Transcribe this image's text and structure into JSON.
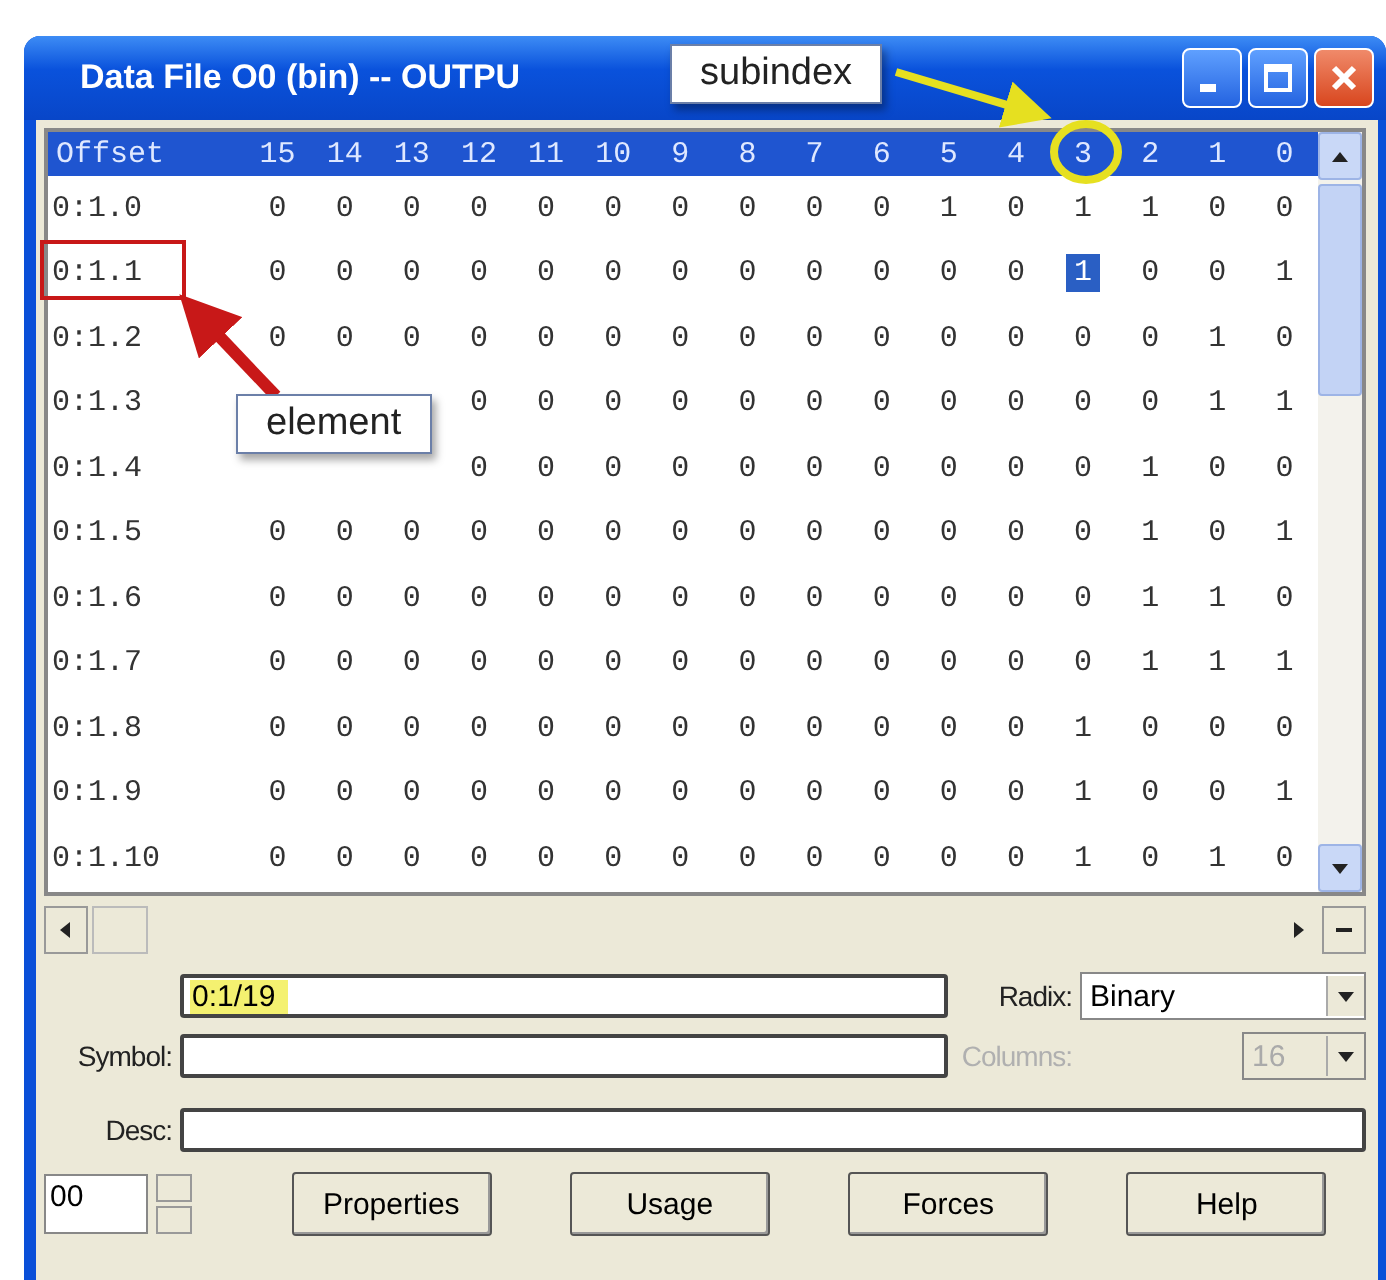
{
  "window": {
    "title": "Data File O0 (bin) -- OUTPU"
  },
  "table": {
    "columns": [
      "Offset",
      "15",
      "14",
      "13",
      "12",
      "11",
      "10",
      "9",
      "8",
      "7",
      "6",
      "5",
      "4",
      "3",
      "2",
      "1",
      "0"
    ],
    "rows": [
      {
        "cells": [
          {
            "v": "0:1.0",
            "selected": false
          },
          {
            "v": "0",
            "selected": false
          },
          {
            "v": "0",
            "selected": false
          },
          {
            "v": "0",
            "selected": false
          },
          {
            "v": "0",
            "selected": false
          },
          {
            "v": "0",
            "selected": false
          },
          {
            "v": "0",
            "selected": false
          },
          {
            "v": "0",
            "selected": false
          },
          {
            "v": "0",
            "selected": false
          },
          {
            "v": "0",
            "selected": false
          },
          {
            "v": "0",
            "selected": false
          },
          {
            "v": "1",
            "selected": false
          },
          {
            "v": "0",
            "selected": false
          },
          {
            "v": "1",
            "selected": false
          },
          {
            "v": "1",
            "selected": false
          },
          {
            "v": "0",
            "selected": false
          },
          {
            "v": "0",
            "selected": false
          }
        ]
      },
      {
        "cells": [
          {
            "v": "0:1.1",
            "selected": false
          },
          {
            "v": "0",
            "selected": false
          },
          {
            "v": "0",
            "selected": false
          },
          {
            "v": "0",
            "selected": false
          },
          {
            "v": "0",
            "selected": false
          },
          {
            "v": "0",
            "selected": false
          },
          {
            "v": "0",
            "selected": false
          },
          {
            "v": "0",
            "selected": false
          },
          {
            "v": "0",
            "selected": false
          },
          {
            "v": "0",
            "selected": false
          },
          {
            "v": "0",
            "selected": false
          },
          {
            "v": "0",
            "selected": false
          },
          {
            "v": "0",
            "selected": false
          },
          {
            "v": "1",
            "selected": true
          },
          {
            "v": "0",
            "selected": false
          },
          {
            "v": "0",
            "selected": false
          },
          {
            "v": "1",
            "selected": false
          }
        ]
      },
      {
        "cells": [
          {
            "v": "0:1.2",
            "selected": false
          },
          {
            "v": "0",
            "selected": false
          },
          {
            "v": "0",
            "selected": false
          },
          {
            "v": "0",
            "selected": false
          },
          {
            "v": "0",
            "selected": false
          },
          {
            "v": "0",
            "selected": false
          },
          {
            "v": "0",
            "selected": false
          },
          {
            "v": "0",
            "selected": false
          },
          {
            "v": "0",
            "selected": false
          },
          {
            "v": "0",
            "selected": false
          },
          {
            "v": "0",
            "selected": false
          },
          {
            "v": "0",
            "selected": false
          },
          {
            "v": "0",
            "selected": false
          },
          {
            "v": "0",
            "selected": false
          },
          {
            "v": "0",
            "selected": false
          },
          {
            "v": "1",
            "selected": false
          },
          {
            "v": "0",
            "selected": false
          }
        ]
      },
      {
        "cells": [
          {
            "v": "0:1.3",
            "selected": false
          },
          null,
          null,
          null,
          {
            "v": "0",
            "selected": false
          },
          {
            "v": "0",
            "selected": false
          },
          {
            "v": "0",
            "selected": false
          },
          {
            "v": "0",
            "selected": false
          },
          {
            "v": "0",
            "selected": false
          },
          {
            "v": "0",
            "selected": false
          },
          {
            "v": "0",
            "selected": false
          },
          {
            "v": "0",
            "selected": false
          },
          {
            "v": "0",
            "selected": false
          },
          {
            "v": "0",
            "selected": false
          },
          {
            "v": "0",
            "selected": false
          },
          {
            "v": "1",
            "selected": false
          },
          {
            "v": "1",
            "selected": false
          }
        ]
      },
      {
        "cells": [
          {
            "v": "0:1.4",
            "selected": false
          },
          null,
          null,
          null,
          {
            "v": "0",
            "selected": false
          },
          {
            "v": "0",
            "selected": false
          },
          {
            "v": "0",
            "selected": false
          },
          {
            "v": "0",
            "selected": false
          },
          {
            "v": "0",
            "selected": false
          },
          {
            "v": "0",
            "selected": false
          },
          {
            "v": "0",
            "selected": false
          },
          {
            "v": "0",
            "selected": false
          },
          {
            "v": "0",
            "selected": false
          },
          {
            "v": "0",
            "selected": false
          },
          {
            "v": "1",
            "selected": false
          },
          {
            "v": "0",
            "selected": false
          },
          {
            "v": "0",
            "selected": false
          }
        ]
      },
      {
        "cells": [
          {
            "v": "0:1.5",
            "selected": false
          },
          {
            "v": "0",
            "selected": false
          },
          {
            "v": "0",
            "selected": false
          },
          {
            "v": "0",
            "selected": false
          },
          {
            "v": "0",
            "selected": false
          },
          {
            "v": "0",
            "selected": false
          },
          {
            "v": "0",
            "selected": false
          },
          {
            "v": "0",
            "selected": false
          },
          {
            "v": "0",
            "selected": false
          },
          {
            "v": "0",
            "selected": false
          },
          {
            "v": "0",
            "selected": false
          },
          {
            "v": "0",
            "selected": false
          },
          {
            "v": "0",
            "selected": false
          },
          {
            "v": "0",
            "selected": false
          },
          {
            "v": "1",
            "selected": false
          },
          {
            "v": "0",
            "selected": false
          },
          {
            "v": "1",
            "selected": false
          }
        ]
      },
      {
        "cells": [
          {
            "v": "0:1.6",
            "selected": false
          },
          {
            "v": "0",
            "selected": false
          },
          {
            "v": "0",
            "selected": false
          },
          {
            "v": "0",
            "selected": false
          },
          {
            "v": "0",
            "selected": false
          },
          {
            "v": "0",
            "selected": false
          },
          {
            "v": "0",
            "selected": false
          },
          {
            "v": "0",
            "selected": false
          },
          {
            "v": "0",
            "selected": false
          },
          {
            "v": "0",
            "selected": false
          },
          {
            "v": "0",
            "selected": false
          },
          {
            "v": "0",
            "selected": false
          },
          {
            "v": "0",
            "selected": false
          },
          {
            "v": "0",
            "selected": false
          },
          {
            "v": "1",
            "selected": false
          },
          {
            "v": "1",
            "selected": false
          },
          {
            "v": "0",
            "selected": false
          }
        ]
      },
      {
        "cells": [
          {
            "v": "0:1.7",
            "selected": false
          },
          {
            "v": "0",
            "selected": false
          },
          {
            "v": "0",
            "selected": false
          },
          {
            "v": "0",
            "selected": false
          },
          {
            "v": "0",
            "selected": false
          },
          {
            "v": "0",
            "selected": false
          },
          {
            "v": "0",
            "selected": false
          },
          {
            "v": "0",
            "selected": false
          },
          {
            "v": "0",
            "selected": false
          },
          {
            "v": "0",
            "selected": false
          },
          {
            "v": "0",
            "selected": false
          },
          {
            "v": "0",
            "selected": false
          },
          {
            "v": "0",
            "selected": false
          },
          {
            "v": "0",
            "selected": false
          },
          {
            "v": "1",
            "selected": false
          },
          {
            "v": "1",
            "selected": false
          },
          {
            "v": "1",
            "selected": false
          }
        ]
      },
      {
        "cells": [
          {
            "v": "0:1.8",
            "selected": false
          },
          {
            "v": "0",
            "selected": false
          },
          {
            "v": "0",
            "selected": false
          },
          {
            "v": "0",
            "selected": false
          },
          {
            "v": "0",
            "selected": false
          },
          {
            "v": "0",
            "selected": false
          },
          {
            "v": "0",
            "selected": false
          },
          {
            "v": "0",
            "selected": false
          },
          {
            "v": "0",
            "selected": false
          },
          {
            "v": "0",
            "selected": false
          },
          {
            "v": "0",
            "selected": false
          },
          {
            "v": "0",
            "selected": false
          },
          {
            "v": "0",
            "selected": false
          },
          {
            "v": "1",
            "selected": false
          },
          {
            "v": "0",
            "selected": false
          },
          {
            "v": "0",
            "selected": false
          },
          {
            "v": "0",
            "selected": false
          }
        ]
      },
      {
        "cells": [
          {
            "v": "0:1.9",
            "selected": false
          },
          {
            "v": "0",
            "selected": false
          },
          {
            "v": "0",
            "selected": false
          },
          {
            "v": "0",
            "selected": false
          },
          {
            "v": "0",
            "selected": false
          },
          {
            "v": "0",
            "selected": false
          },
          {
            "v": "0",
            "selected": false
          },
          {
            "v": "0",
            "selected": false
          },
          {
            "v": "0",
            "selected": false
          },
          {
            "v": "0",
            "selected": false
          },
          {
            "v": "0",
            "selected": false
          },
          {
            "v": "0",
            "selected": false
          },
          {
            "v": "0",
            "selected": false
          },
          {
            "v": "1",
            "selected": false
          },
          {
            "v": "0",
            "selected": false
          },
          {
            "v": "0",
            "selected": false
          },
          {
            "v": "1",
            "selected": false
          }
        ]
      },
      {
        "cells": [
          {
            "v": "0:1.10",
            "selected": false
          },
          {
            "v": "0",
            "selected": false
          },
          {
            "v": "0",
            "selected": false
          },
          {
            "v": "0",
            "selected": false
          },
          {
            "v": "0",
            "selected": false
          },
          {
            "v": "0",
            "selected": false
          },
          {
            "v": "0",
            "selected": false
          },
          {
            "v": "0",
            "selected": false
          },
          {
            "v": "0",
            "selected": false
          },
          {
            "v": "0",
            "selected": false
          },
          {
            "v": "0",
            "selected": false
          },
          {
            "v": "0",
            "selected": false
          },
          {
            "v": "0",
            "selected": false
          },
          {
            "v": "1",
            "selected": false
          },
          {
            "v": "0",
            "selected": false
          },
          {
            "v": "1",
            "selected": false
          },
          {
            "v": "0",
            "selected": false
          }
        ]
      }
    ]
  },
  "address": {
    "value": "0:1/19",
    "highlighted": true
  },
  "radix": {
    "label": "Radix:",
    "value": "Binary"
  },
  "symbol": {
    "label": "Symbol:"
  },
  "columns": {
    "label": "Columns:",
    "value": "16",
    "disabled": true
  },
  "desc": {
    "label": "Desc:"
  },
  "file_number": {
    "value": "00"
  },
  "buttons": [
    "Properties",
    "Usage",
    "Forces",
    "Help"
  ],
  "annotations": [
    {
      "kind": "callout",
      "text": "subindex"
    },
    {
      "kind": "callout",
      "text": "element"
    }
  ]
}
